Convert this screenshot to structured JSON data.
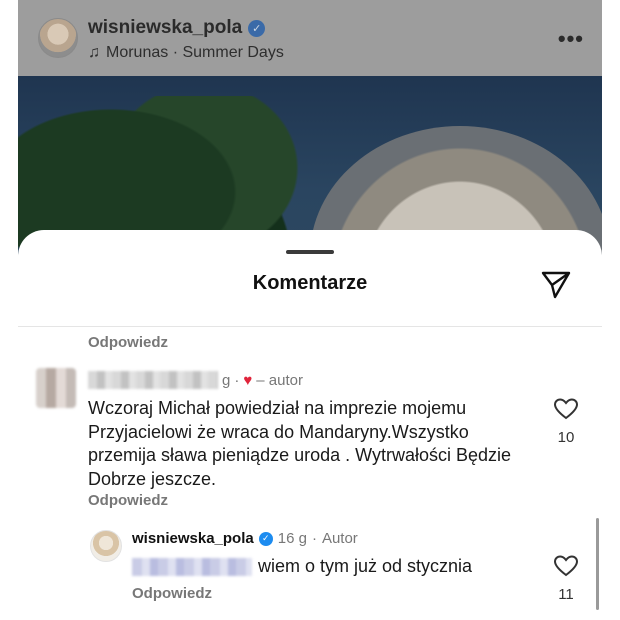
{
  "post": {
    "username": "wisniewska_pola",
    "verified_icon": "verified-badge-icon",
    "music": "Morunas · Summer Days",
    "music_icon": "music-note-icon",
    "more_label": "•••"
  },
  "sheet": {
    "title": "Komentarze",
    "share_icon": "send-icon",
    "reply_top": "Odpowiedz"
  },
  "comment1": {
    "username_suffix": "g",
    "separator": "·",
    "heart": "♥",
    "author_label": "– autor",
    "text": "Wczoraj Michał powiedział na imprezie mojemu Przyjacielowi że wraca do Mandaryny.Wszystko przemija sława pieniądze uroda . Wytrwałości Będzie Dobrze jeszcze.",
    "reply_label": "Odpowiedz",
    "likes": "10"
  },
  "comment2": {
    "username": "wisniewska_pola",
    "verified_mark": "✓",
    "time": "16 g",
    "separator": "·",
    "author_label": "Autor",
    "text": "wiem o tym już od stycznia",
    "reply_label": "Odpowiedz",
    "likes": "11"
  },
  "colors": {
    "heart_red": "#e0243b",
    "verified_blue": "#1d8cf0",
    "secondary_text": "#777777"
  }
}
